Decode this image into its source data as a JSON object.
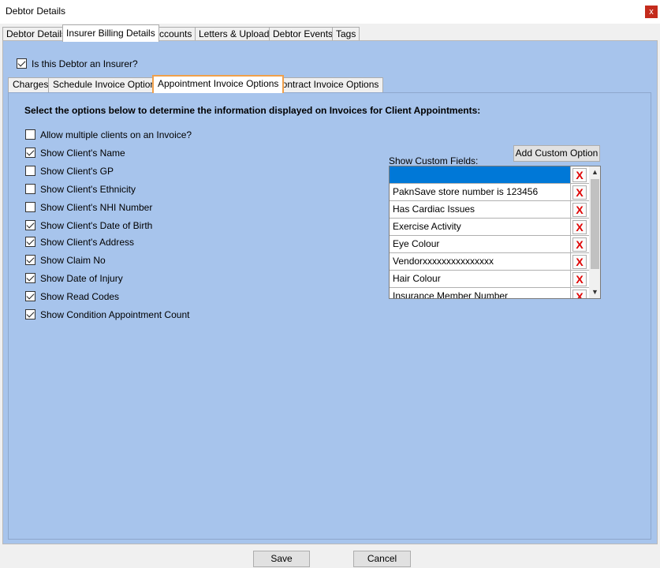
{
  "window": {
    "title": "Debtor Details",
    "close_label": "x"
  },
  "main_tabs": [
    {
      "label": "Debtor Details"
    },
    {
      "label": "Insurer Billing Details"
    },
    {
      "label": "Accounts"
    },
    {
      "label": "Letters & Uploads"
    },
    {
      "label": "Debtor Events"
    },
    {
      "label": "Tags"
    }
  ],
  "is_insurer": {
    "label": "Is this Debtor an Insurer?",
    "checked": true
  },
  "sub_tabs": [
    {
      "label": "Charges"
    },
    {
      "label": "Schedule Invoice Options"
    },
    {
      "label": "Appointment Invoice Options"
    },
    {
      "label": "Contract Invoice Options"
    }
  ],
  "heading": "Select the options below to determine the information displayed on Invoices for Client Appointments:",
  "options": [
    {
      "label": "Allow multiple clients on an Invoice?",
      "checked": false
    },
    {
      "label": "Show Client's Name",
      "checked": true
    },
    {
      "label": "Show Client's GP",
      "checked": false
    },
    {
      "label": "Show Client's Ethnicity",
      "checked": false
    },
    {
      "label": "Show Client's NHI Number",
      "checked": false
    },
    {
      "label": "Show Client's Date of Birth",
      "checked": true
    },
    {
      "label": "Show Client's Address",
      "checked": true
    },
    {
      "label": "Show Claim No",
      "checked": true
    },
    {
      "label": "Show Date of Injury",
      "checked": true
    },
    {
      "label": "Show Read Codes",
      "checked": true
    },
    {
      "label": "Show Condition Appointment Count",
      "checked": true
    }
  ],
  "custom": {
    "label": "Show Custom Fields:",
    "add_button": "Add Custom Option",
    "delete_glyph": "X",
    "rows": [
      {
        "value": ""
      },
      {
        "value": "PaknSave store number is 123456"
      },
      {
        "value": "Has Cardiac Issues"
      },
      {
        "value": "Exercise Activity"
      },
      {
        "value": "Eye Colour"
      },
      {
        "value": "Vendorxxxxxxxxxxxxxxx"
      },
      {
        "value": "Hair Colour"
      },
      {
        "value": "Insurance Member Number"
      }
    ]
  },
  "footer": {
    "save_label": "Save",
    "cancel_label": "Cancel"
  }
}
